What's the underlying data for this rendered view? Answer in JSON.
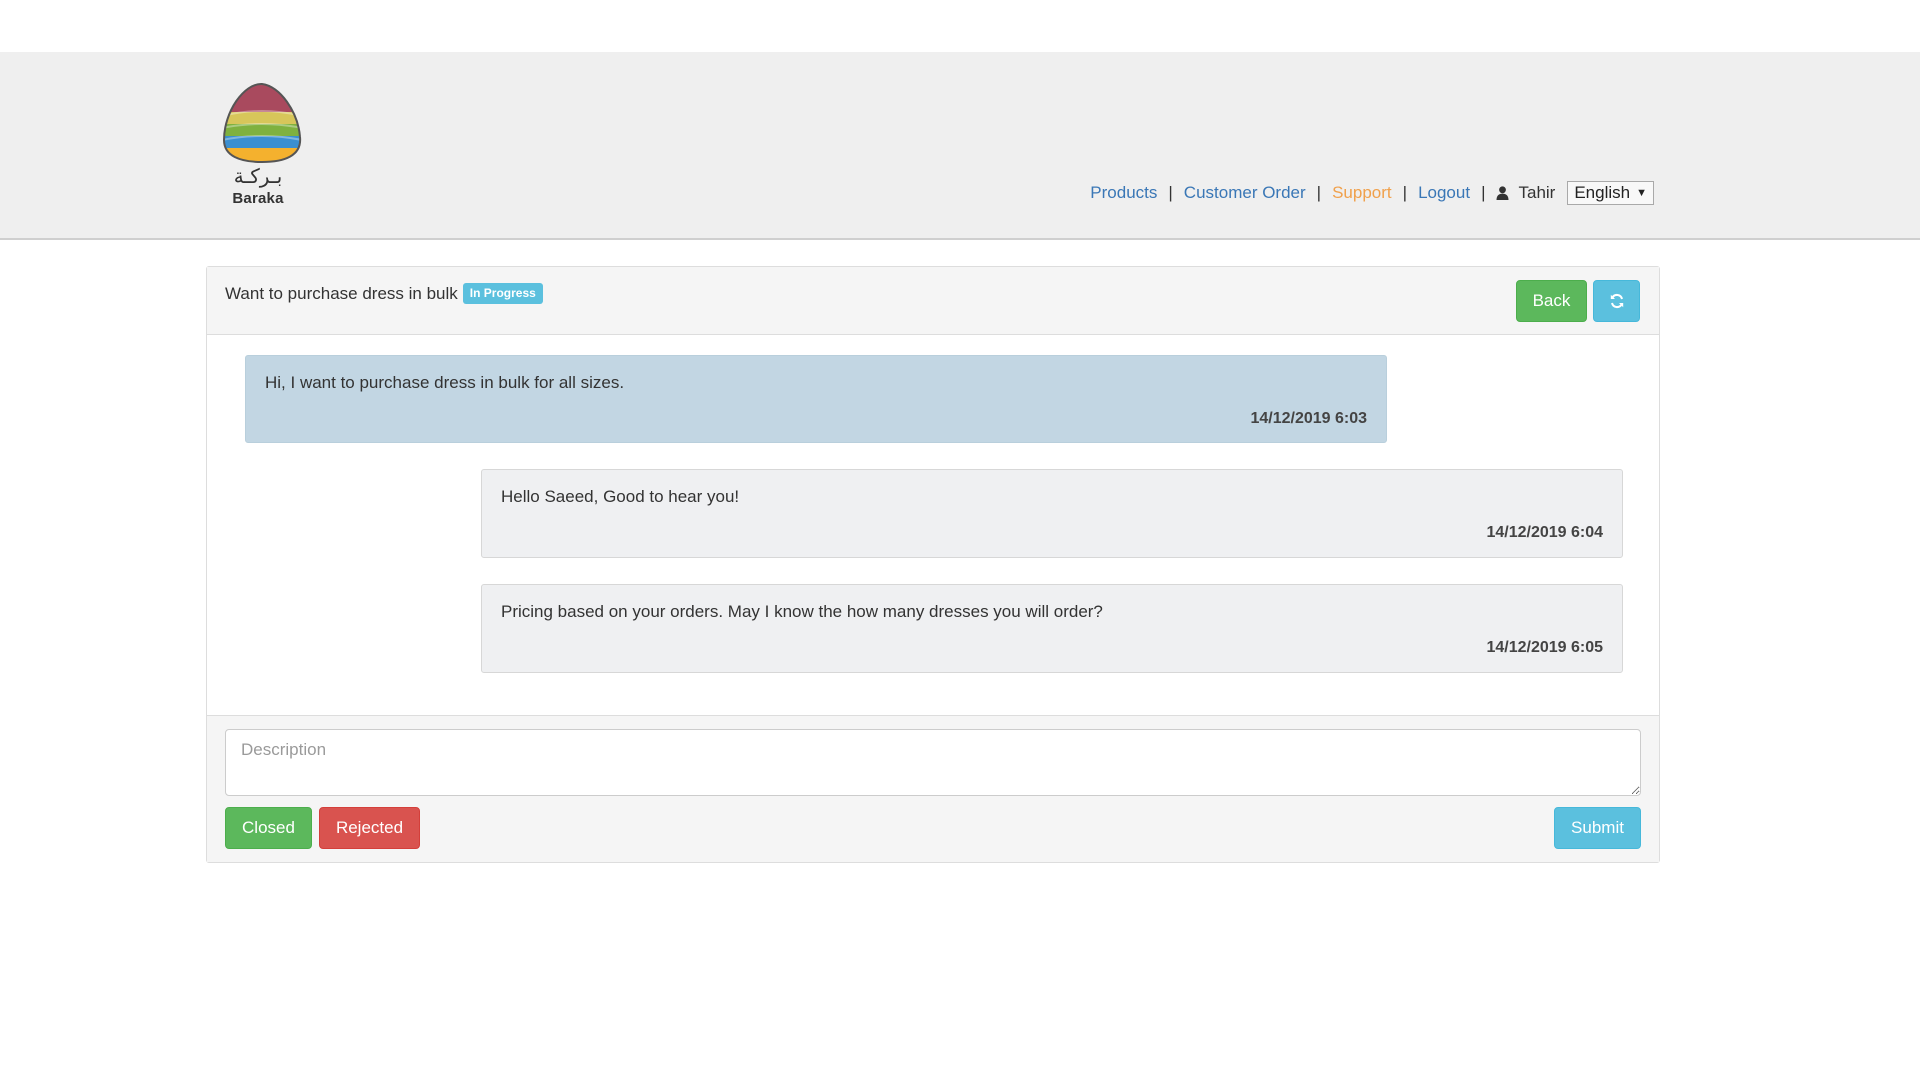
{
  "brand": {
    "arabic_name": "بـركـة",
    "latin_name": "Baraka",
    "logo_colors": [
      "#a94a5e",
      "#7fb13f",
      "#3b8fd0",
      "#f4b12e"
    ]
  },
  "nav": {
    "items": [
      {
        "label": "Products",
        "active": false
      },
      {
        "label": "Customer Order",
        "active": false
      },
      {
        "label": "Support",
        "active": true
      },
      {
        "label": "Logout",
        "active": false
      }
    ],
    "separator": "|",
    "user_name": "Tahir",
    "user_icon": "user-icon",
    "language": "English"
  },
  "ticket": {
    "title": "Want to purchase dress in bulk",
    "status": "In Progress",
    "back_label": "Back",
    "refresh_icon": "refresh-icon"
  },
  "messages": [
    {
      "text": "Hi, I want to purchase dress in bulk for all sizes.",
      "time": "14/12/2019 6:03",
      "direction": "incoming"
    },
    {
      "text": "Hello Saeed, Good to hear you!",
      "time": "14/12/2019 6:04",
      "direction": "outgoing"
    },
    {
      "text": "Pricing based on your orders. May I know the how many dresses you will order?",
      "time": "14/12/2019 6:05",
      "direction": "outgoing"
    }
  ],
  "reply": {
    "placeholder": "Description",
    "closed_label": "Closed",
    "rejected_label": "Rejected",
    "submit_label": "Submit"
  },
  "colors": {
    "success": "#5cb85c",
    "danger": "#d9534f",
    "info": "#5bc0de",
    "link": "#3a77b6",
    "active_link": "#f0a04b"
  }
}
